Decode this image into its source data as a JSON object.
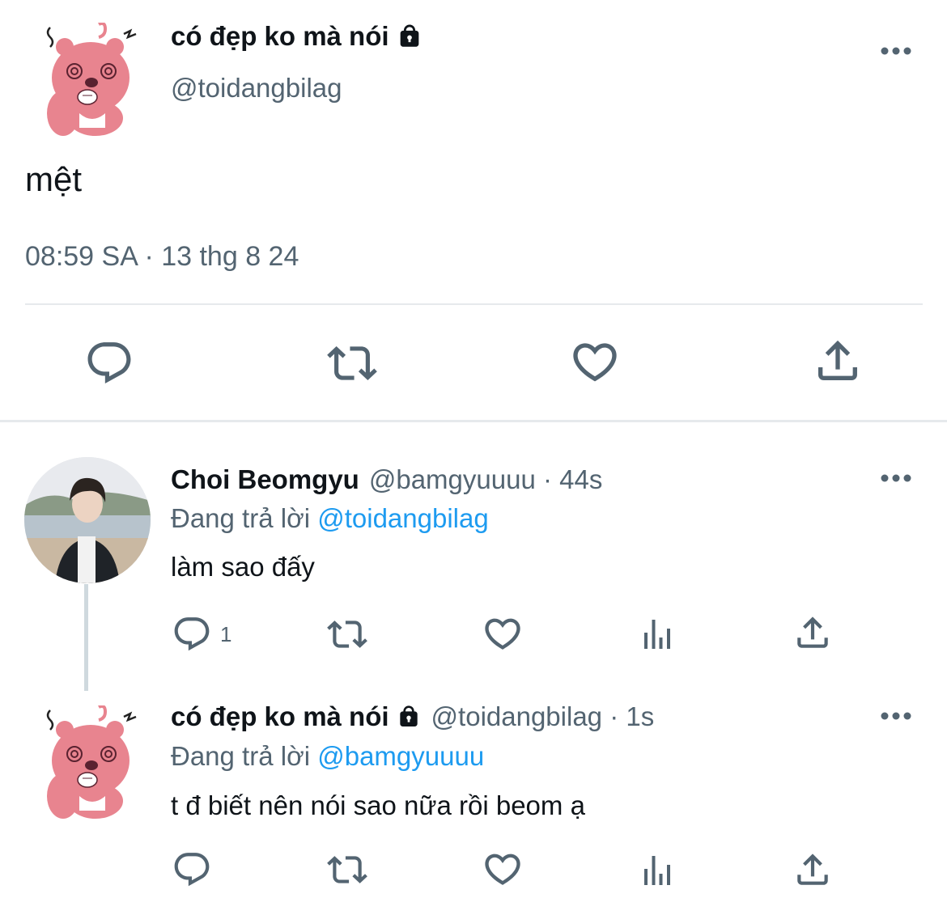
{
  "main_tweet": {
    "display_name": "có đẹp ko mà nói",
    "handle": "@toidangbilag",
    "text": "mệt",
    "timestamp": "08:59 SA · 13 thg 8 24",
    "icons": [
      "lock-icon",
      "more-icon",
      "reply-icon",
      "retweet-icon",
      "like-icon",
      "share-icon"
    ]
  },
  "replies": [
    {
      "display_name": "Choi Beomgyu",
      "meta": "@bamgyuuuu · 44s",
      "replying_label": "Đang trả lời",
      "replying_to": "@toidangbilag",
      "text": "làm sao đấy",
      "reply_count": "1"
    },
    {
      "display_name": "có đẹp ko mà nói",
      "meta": "@toidangbilag · 1s",
      "replying_label": "Đang trả lời",
      "replying_to": "@bamgyuuuu",
      "text": "t đ biết nên nói sao nữa rồi beom ạ",
      "reply_count": ""
    }
  ],
  "colors": {
    "text": "#0f1419",
    "secondary": "#536471",
    "link": "#1d9bf0",
    "avatar_pink": "#e8848f",
    "divider": "#e6e9ec"
  }
}
